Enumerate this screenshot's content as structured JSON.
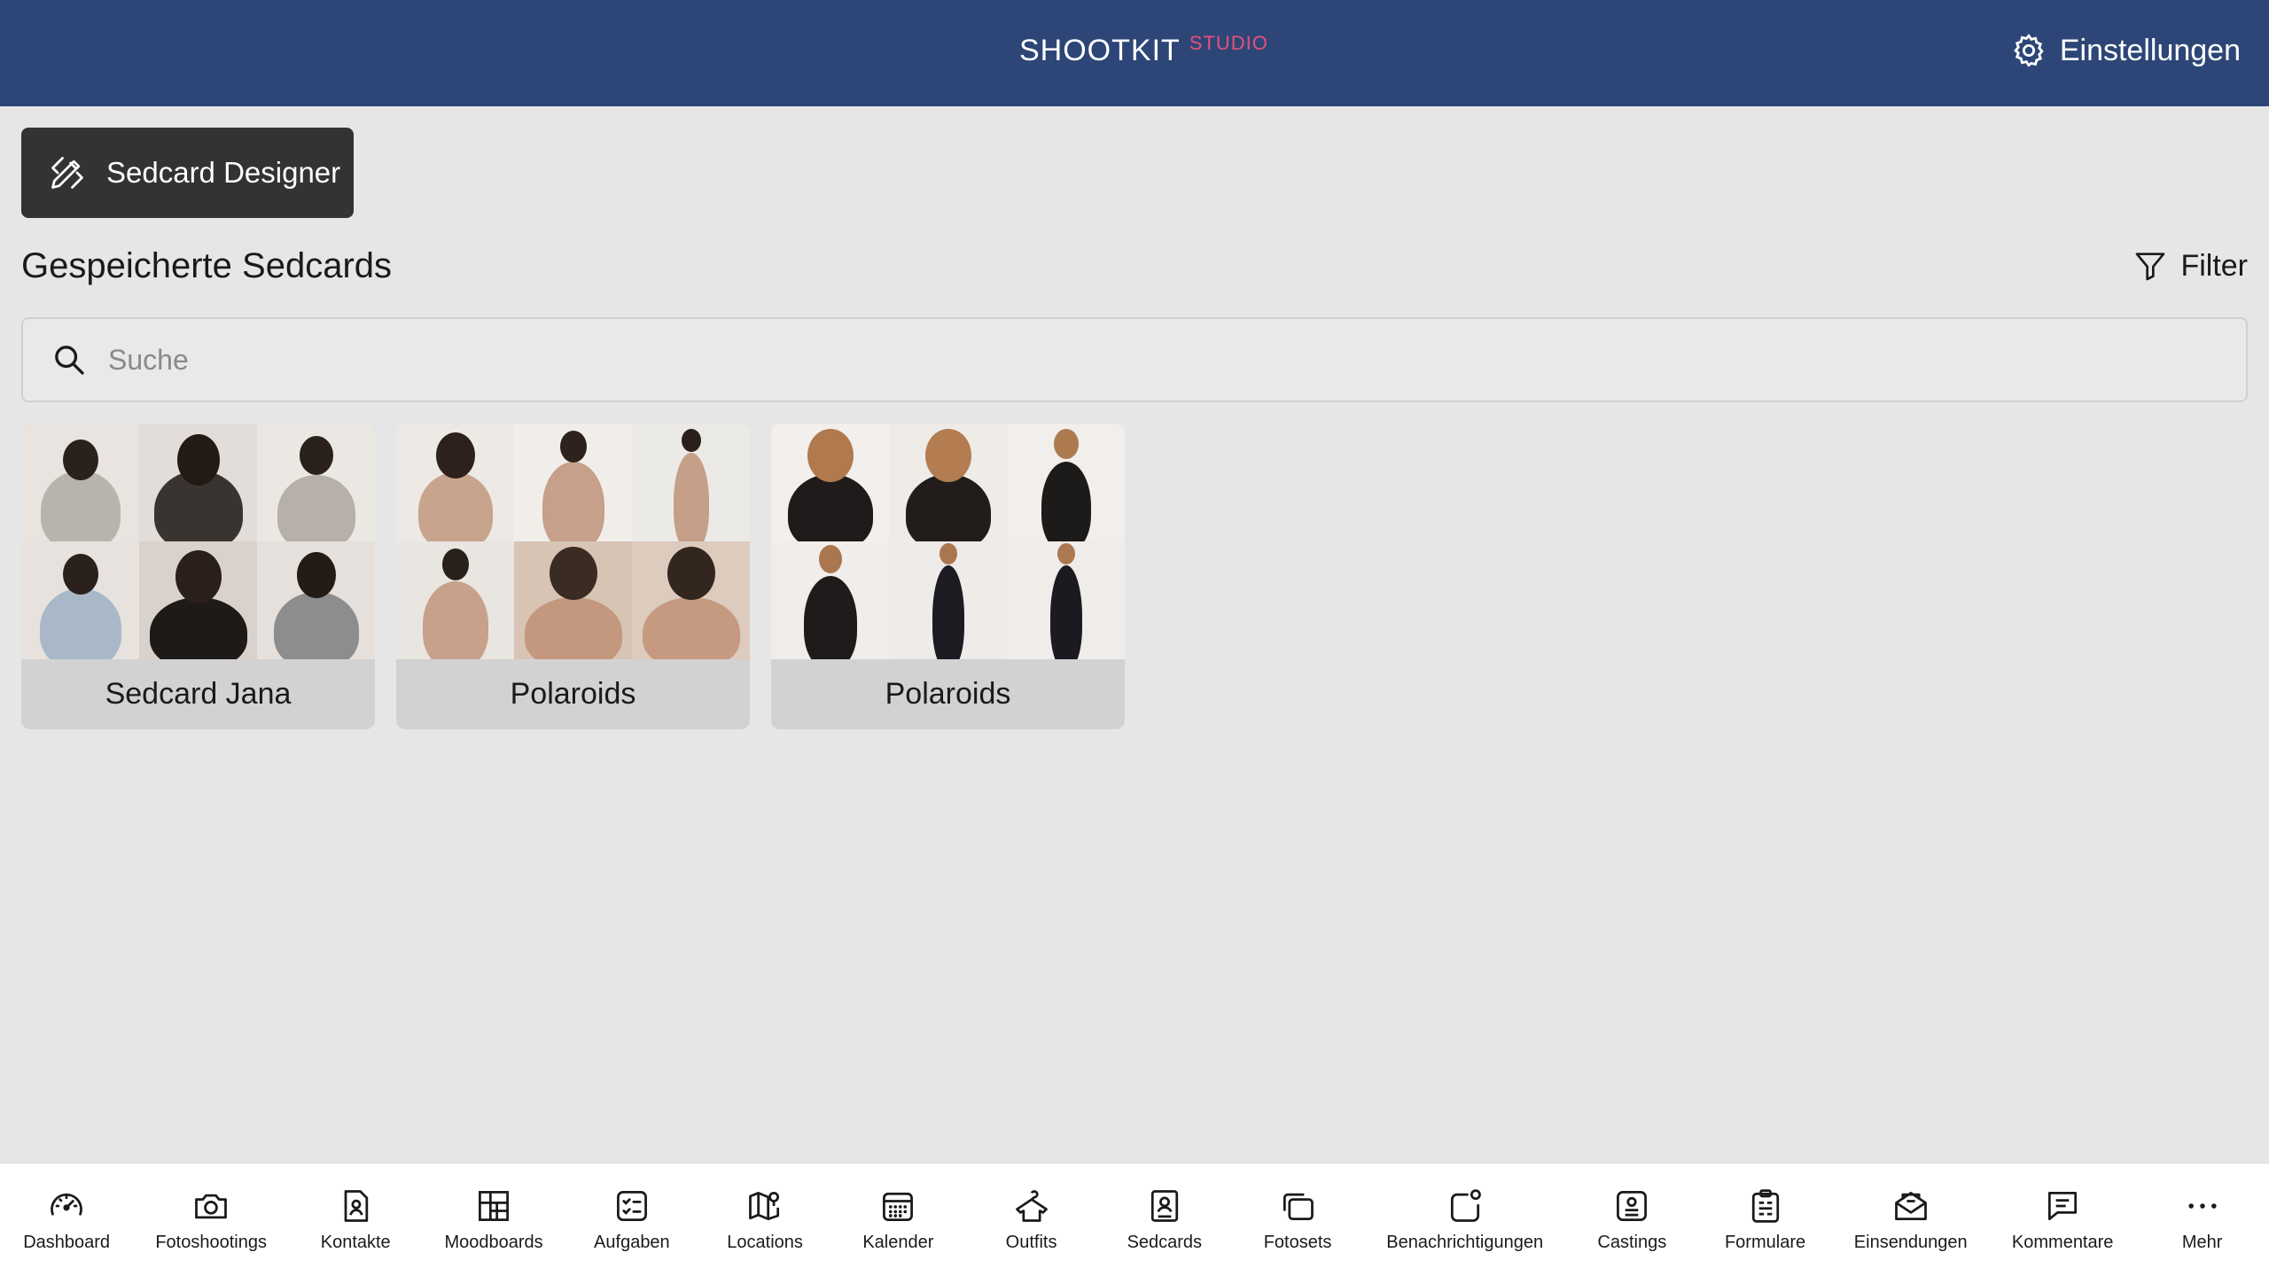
{
  "header": {
    "brand": "SHOOTKIT",
    "brand_suffix": "STUDIO",
    "settings_label": "Einstellungen",
    "colors": {
      "bar": "#2d4677",
      "accent": "#e6507a"
    }
  },
  "designer_button": {
    "label": "Sedcard Designer",
    "icon": "design-tools-icon"
  },
  "section": {
    "title": "Gespeicherte Sedcards",
    "filter_label": "Filter"
  },
  "search": {
    "placeholder": "Suche",
    "value": ""
  },
  "cards": [
    {
      "label": "Sedcard Jana"
    },
    {
      "label": "Polaroids"
    },
    {
      "label": "Polaroids"
    }
  ],
  "bottom_nav": [
    {
      "label": "Dashboard",
      "icon": "dashboard-icon"
    },
    {
      "label": "Fotoshootings",
      "icon": "camera-icon"
    },
    {
      "label": "Kontakte",
      "icon": "contact-icon"
    },
    {
      "label": "Moodboards",
      "icon": "moodboard-icon"
    },
    {
      "label": "Aufgaben",
      "icon": "tasks-icon"
    },
    {
      "label": "Locations",
      "icon": "map-icon"
    },
    {
      "label": "Kalender",
      "icon": "calendar-icon"
    },
    {
      "label": "Outfits",
      "icon": "shirt-icon"
    },
    {
      "label": "Sedcards",
      "icon": "sedcard-icon"
    },
    {
      "label": "Fotosets",
      "icon": "photo-stack-icon"
    },
    {
      "label": "Benachrichtigungen",
      "icon": "notification-icon"
    },
    {
      "label": "Castings",
      "icon": "casting-icon"
    },
    {
      "label": "Formulare",
      "icon": "clipboard-icon"
    },
    {
      "label": "Einsendungen",
      "icon": "envelope-icon"
    },
    {
      "label": "Kommentare",
      "icon": "comment-icon"
    },
    {
      "label": "Mehr",
      "icon": "more-icon"
    }
  ]
}
